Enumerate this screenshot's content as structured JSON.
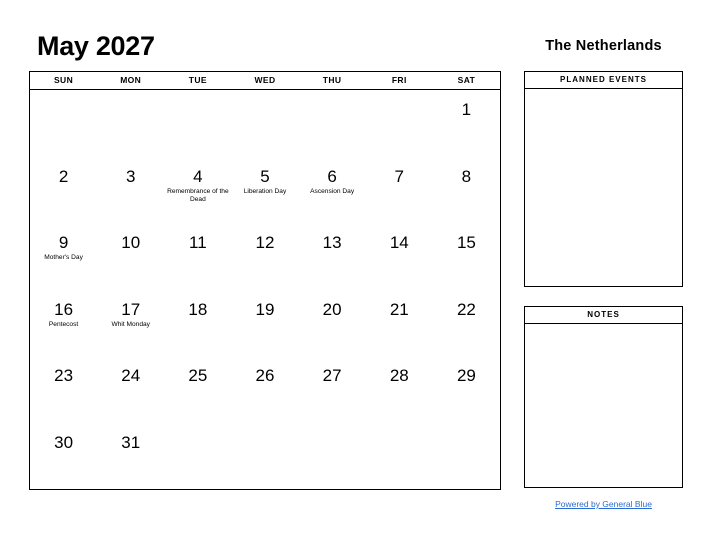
{
  "page": {
    "title": "May 2027",
    "country": "The Netherlands",
    "footer_link": "Powered by General Blue",
    "link_color": "#2b6cd4"
  },
  "calendar": {
    "month": "May",
    "year": "2027",
    "weekday_headers": [
      "SUN",
      "MON",
      "TUE",
      "WED",
      "THU",
      "FRI",
      "SAT"
    ],
    "weeks": [
      [
        {
          "day": "",
          "event": ""
        },
        {
          "day": "",
          "event": ""
        },
        {
          "day": "",
          "event": ""
        },
        {
          "day": "",
          "event": ""
        },
        {
          "day": "",
          "event": ""
        },
        {
          "day": "",
          "event": ""
        },
        {
          "day": "1",
          "event": ""
        }
      ],
      [
        {
          "day": "2",
          "event": ""
        },
        {
          "day": "3",
          "event": ""
        },
        {
          "day": "4",
          "event": "Remembrance of the Dead"
        },
        {
          "day": "5",
          "event": "Liberation Day"
        },
        {
          "day": "6",
          "event": "Ascension Day"
        },
        {
          "day": "7",
          "event": ""
        },
        {
          "day": "8",
          "event": ""
        }
      ],
      [
        {
          "day": "9",
          "event": "Mother's Day"
        },
        {
          "day": "10",
          "event": ""
        },
        {
          "day": "11",
          "event": ""
        },
        {
          "day": "12",
          "event": ""
        },
        {
          "day": "13",
          "event": ""
        },
        {
          "day": "14",
          "event": ""
        },
        {
          "day": "15",
          "event": ""
        }
      ],
      [
        {
          "day": "16",
          "event": "Pentecost"
        },
        {
          "day": "17",
          "event": "Whit Monday"
        },
        {
          "day": "18",
          "event": ""
        },
        {
          "day": "19",
          "event": ""
        },
        {
          "day": "20",
          "event": ""
        },
        {
          "day": "21",
          "event": ""
        },
        {
          "day": "22",
          "event": ""
        }
      ],
      [
        {
          "day": "23",
          "event": ""
        },
        {
          "day": "24",
          "event": ""
        },
        {
          "day": "25",
          "event": ""
        },
        {
          "day": "26",
          "event": ""
        },
        {
          "day": "27",
          "event": ""
        },
        {
          "day": "28",
          "event": ""
        },
        {
          "day": "29",
          "event": ""
        }
      ],
      [
        {
          "day": "30",
          "event": ""
        },
        {
          "day": "31",
          "event": ""
        },
        {
          "day": "",
          "event": ""
        },
        {
          "day": "",
          "event": ""
        },
        {
          "day": "",
          "event": ""
        },
        {
          "day": "",
          "event": ""
        },
        {
          "day": "",
          "event": ""
        }
      ]
    ]
  },
  "panels": {
    "planned_events": {
      "title": "PLANNED EVENTS",
      "body": ""
    },
    "notes": {
      "title": "NOTES",
      "body": ""
    }
  }
}
